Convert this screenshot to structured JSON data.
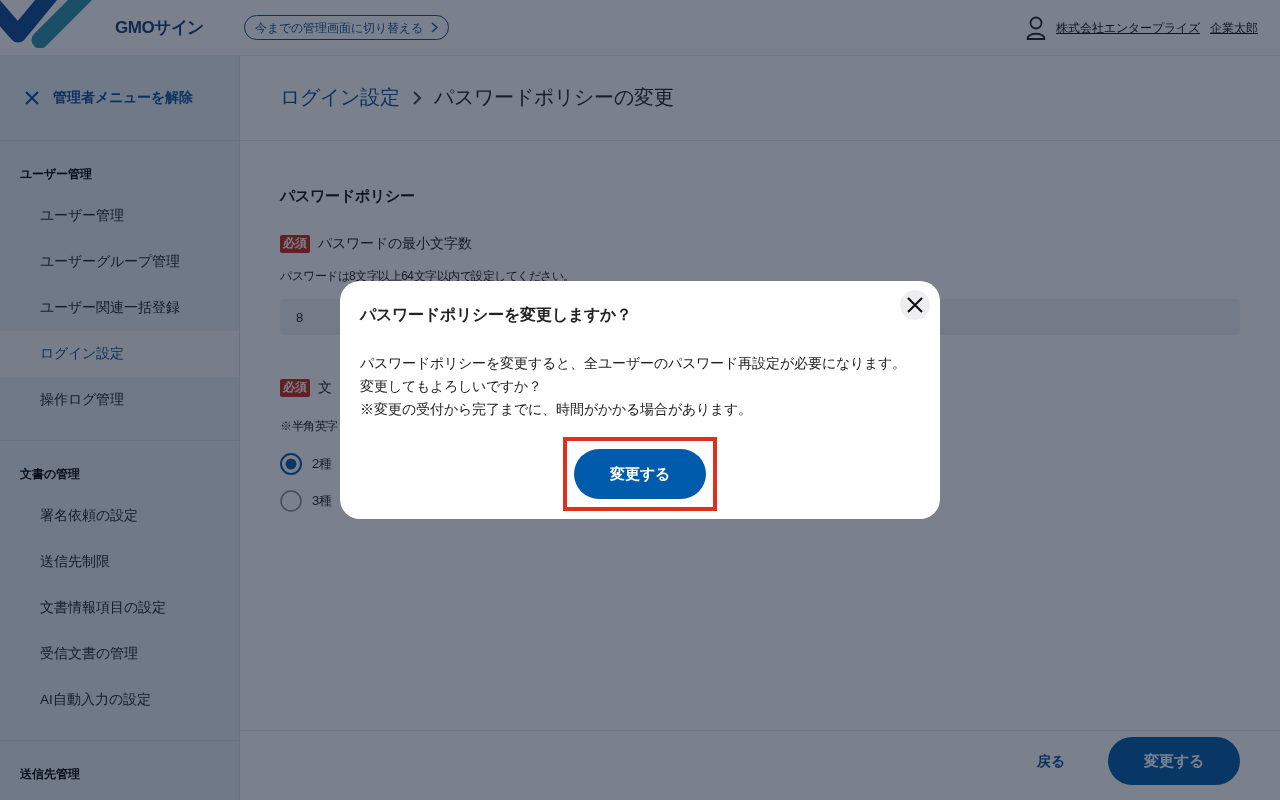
{
  "header": {
    "logo_text": "GMOサイン",
    "switch_button": "今までの管理画面に切り替える",
    "company_link": "株式会社エンタープライズ",
    "user_link": "企業太郎"
  },
  "sidebar": {
    "close_label": "管理者メニューを解除",
    "sections": [
      {
        "title": "ユーザー管理",
        "items": [
          {
            "label": "ユーザー管理",
            "selected": false
          },
          {
            "label": "ユーザーグループ管理",
            "selected": false
          },
          {
            "label": "ユーザー関連一括登録",
            "selected": false
          },
          {
            "label": "ログイン設定",
            "selected": true
          },
          {
            "label": "操作ログ管理",
            "selected": false
          }
        ]
      },
      {
        "title": "文書の管理",
        "items": [
          {
            "label": "署名依頼の設定",
            "selected": false
          },
          {
            "label": "送信先制限",
            "selected": false
          },
          {
            "label": "文書情報項目の設定",
            "selected": false
          },
          {
            "label": "受信文書の管理",
            "selected": false
          },
          {
            "label": "AI自動入力の設定",
            "selected": false
          }
        ]
      },
      {
        "title": "送信先管理"
      }
    ]
  },
  "page": {
    "breadcrumb": [
      {
        "label": "ログイン設定",
        "kind": "link"
      },
      {
        "label": "パスワードポリシーの変更",
        "kind": "current"
      }
    ],
    "section_title": "パスワードポリシー",
    "fields": [
      {
        "kind": "number",
        "badge": "必須",
        "label": "パスワードの最小文字数",
        "hint": "パスワードは8文字以上64文字以内で設定してください。",
        "value": "8"
      },
      {
        "kind": "radio",
        "badge": "必須",
        "label": "文",
        "hint": "※半角英字",
        "options": [
          {
            "label": "2種",
            "selected": true
          },
          {
            "label": "3種",
            "selected": false
          }
        ]
      }
    ]
  },
  "footer": {
    "back_link": "戻る",
    "submit_button": "変更する"
  },
  "dialog": {
    "title": "パスワードポリシーを変更しますか？",
    "lines": [
      "パスワードポリシーを変更すると、全ユーザーのパスワード再設定が必要になります。",
      "変更してもよろしいですか？",
      "※変更の受付から完了までに、時間がかかる場合があります。"
    ],
    "confirm_button": "変更する",
    "confirm_highlighted": true
  }
}
